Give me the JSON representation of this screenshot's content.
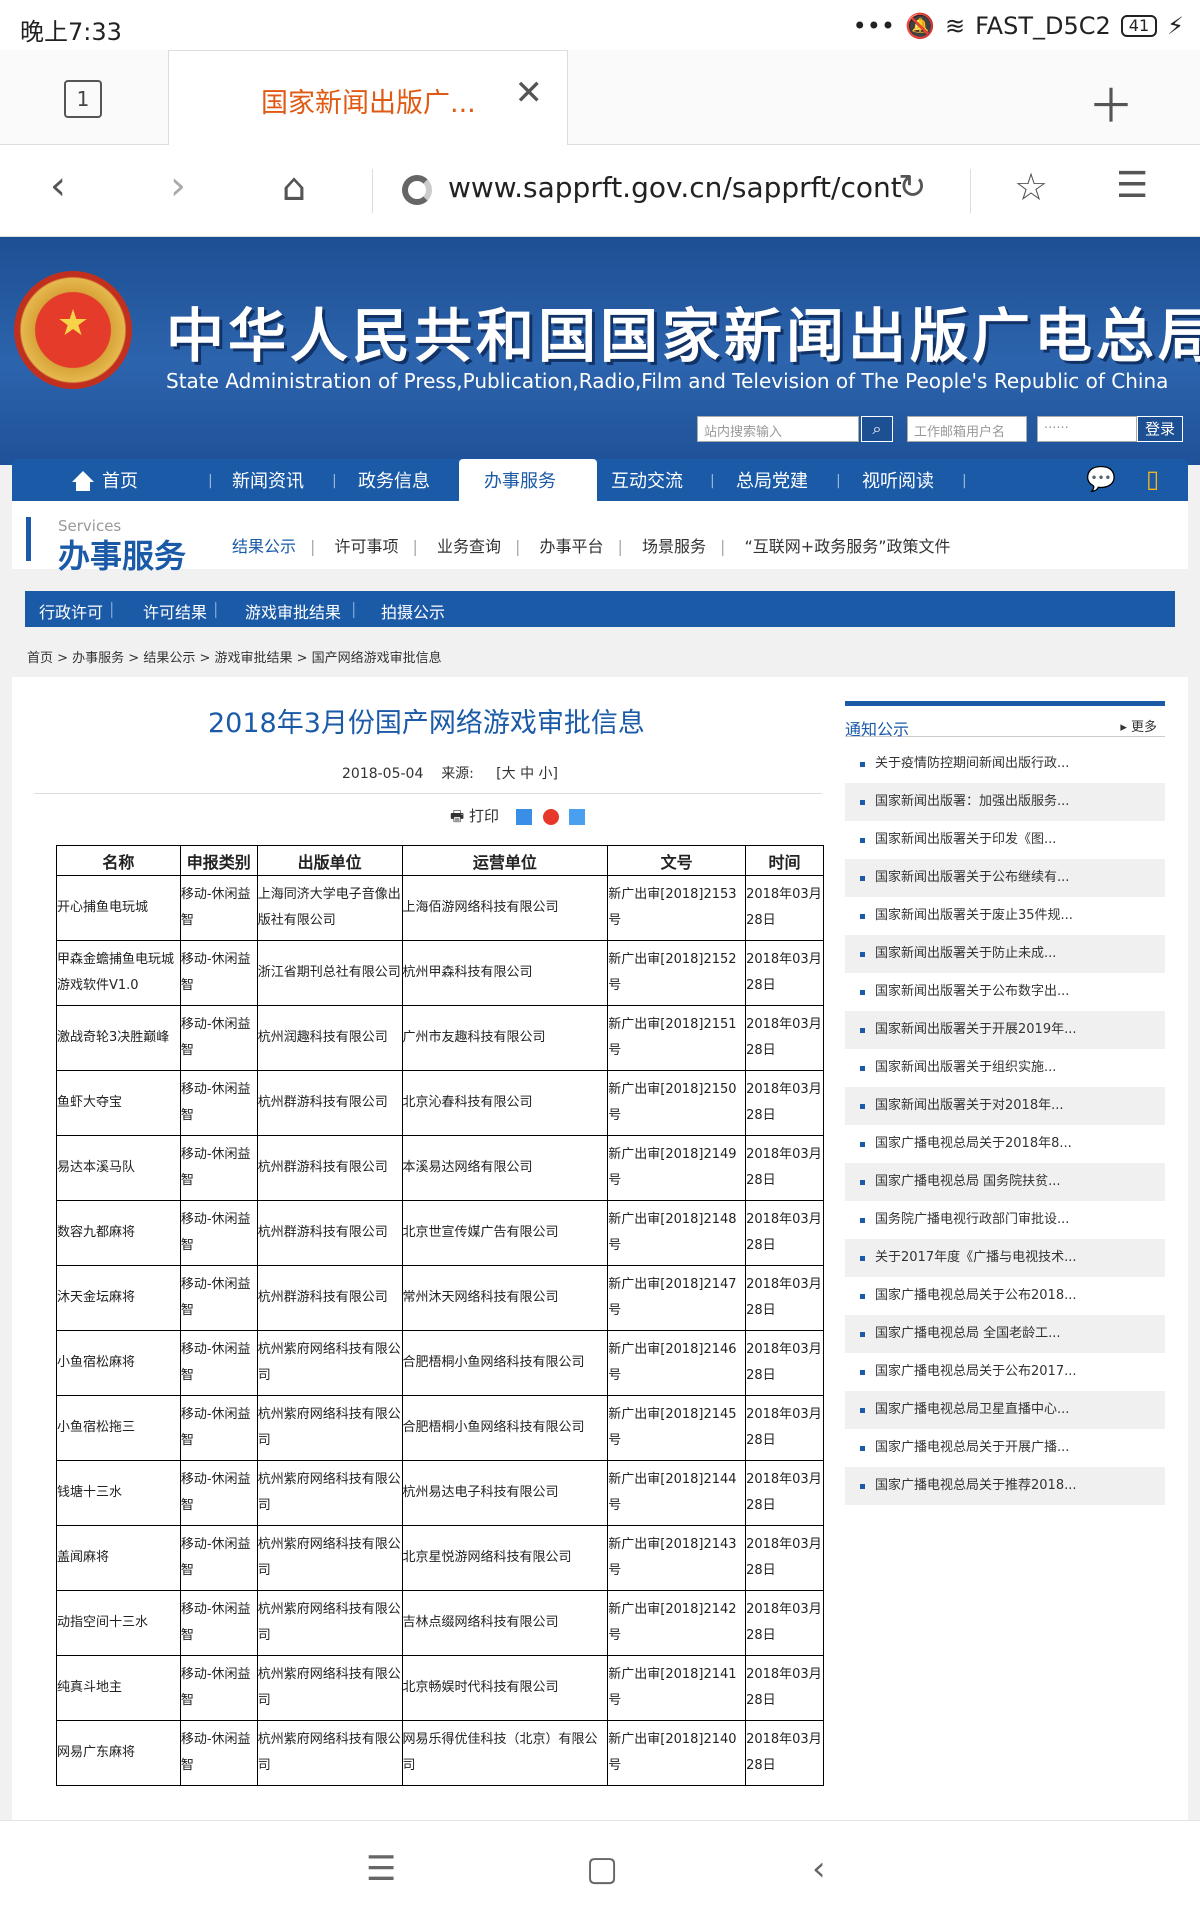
{
  "status": {
    "time": "晚上7:33",
    "wifi": "FAST_D5C2",
    "battery": "41"
  },
  "browser": {
    "tab_count": "1",
    "tab_title": "国家新闻出版广...",
    "url": "www.sapprft.gov.cn/sapprft/cont"
  },
  "header": {
    "title": "中华人民共和国国家新闻出版广电总局",
    "subtitle": "State Administration of Press,Publication,Radio,Film and Television of The People's Republic of China",
    "search_placeholder": "站内搜索输入",
    "mail_placeholder": "工作邮箱用户名",
    "password_placeholder": "······",
    "login_label": "登录"
  },
  "main_nav": [
    {
      "label": "首页"
    },
    {
      "label": "新闻资讯"
    },
    {
      "label": "政务信息"
    },
    {
      "label": "办事服务"
    },
    {
      "label": "互动交流"
    },
    {
      "label": "总局党建"
    },
    {
      "label": "视听阅读"
    }
  ],
  "services": {
    "word": "Services",
    "title": "办事服务",
    "links": [
      "结果公示",
      "许可事项",
      "业务查询",
      "办事平台",
      "场景服务",
      "“互联网+政务服务”政策文件"
    ]
  },
  "tab_nav": [
    "行政许可",
    "许可结果",
    "游戏审批结果",
    "拍摄公示"
  ],
  "breadcrumb": "首页 > 办事服务 > 结果公示 > 游戏审批结果 > 国产网络游戏审批信息",
  "article": {
    "title": "2018年3月份国产网络游戏审批信息",
    "date": "2018-05-04",
    "source_label": "来源:",
    "size_label": "[大 中 小]",
    "print_label": "打印"
  },
  "table": {
    "headers": [
      "名称",
      "申报类别",
      "出版单位",
      "运营单位",
      "文号",
      "时间"
    ],
    "rows": [
      [
        "开心捕鱼电玩城",
        "移动-休闲益智",
        "上海同济大学电子音像出版社有限公司",
        "上海佰游网络科技有限公司",
        "新广出审[2018]2153号",
        "2018年03月28日"
      ],
      [
        "甲森金蟾捕鱼电玩城游戏软件V1.0",
        "移动-休闲益智",
        "浙江省期刊总社有限公司",
        "杭州甲森科技有限公司",
        "新广出审[2018]2152号",
        "2018年03月28日"
      ],
      [
        "激战奇轮3决胜巅峰",
        "移动-休闲益智",
        "杭州润趣科技有限公司",
        "广州市友趣科技有限公司",
        "新广出审[2018]2151号",
        "2018年03月28日"
      ],
      [
        "鱼虾大夺宝",
        "移动-休闲益智",
        "杭州群游科技有限公司",
        "北京沁春科技有限公司",
        "新广出审[2018]2150号",
        "2018年03月28日"
      ],
      [
        "易达本溪马队",
        "移动-休闲益智",
        "杭州群游科技有限公司",
        "本溪易达网络有限公司",
        "新广出审[2018]2149号",
        "2018年03月28日"
      ],
      [
        "数容九都麻将",
        "移动-休闲益智",
        "杭州群游科技有限公司",
        "北京世宣传媒广告有限公司",
        "新广出审[2018]2148号",
        "2018年03月28日"
      ],
      [
        "沐天金坛麻将",
        "移动-休闲益智",
        "杭州群游科技有限公司",
        "常州沐天网络科技有限公司",
        "新广出审[2018]2147号",
        "2018年03月28日"
      ],
      [
        "小鱼宿松麻将",
        "移动-休闲益智",
        "杭州紫府网络科技有限公司",
        "合肥梧桐小鱼网络科技有限公司",
        "新广出审[2018]2146号",
        "2018年03月28日"
      ],
      [
        "小鱼宿松拖三",
        "移动-休闲益智",
        "杭州紫府网络科技有限公司",
        "合肥梧桐小鱼网络科技有限公司",
        "新广出审[2018]2145号",
        "2018年03月28日"
      ],
      [
        "钱塘十三水",
        "移动-休闲益智",
        "杭州紫府网络科技有限公司",
        "杭州易达电子科技有限公司",
        "新广出审[2018]2144号",
        "2018年03月28日"
      ],
      [
        "盖闻麻将",
        "移动-休闲益智",
        "杭州紫府网络科技有限公司",
        "北京星悦游网络科技有限公司",
        "新广出审[2018]2143号",
        "2018年03月28日"
      ],
      [
        "动指空间十三水",
        "移动-休闲益智",
        "杭州紫府网络科技有限公司",
        "吉林点缀网络科技有限公司",
        "新广出审[2018]2142号",
        "2018年03月28日"
      ],
      [
        "纯真斗地主",
        "移动-休闲益智",
        "杭州紫府网络科技有限公司",
        "北京畅娱时代科技有限公司",
        "新广出审[2018]2141号",
        "2018年03月28日"
      ],
      [
        "网易广东麻将",
        "移动-休闲益智",
        "杭州紫府网络科技有限公司",
        "网易乐得优佳科技（北京）有限公司",
        "新广出审[2018]2140号",
        "2018年03月28日"
      ]
    ]
  },
  "sidebar": {
    "title": "通知公示",
    "more": "▸ 更多",
    "items": [
      "关于疫情防控期间新闻出版行政...",
      "国家新闻出版署：加强出版服务...",
      "国家新闻出版署关于印发《图...",
      "国家新闻出版署关于公布继续有...",
      "国家新闻出版署关于废止35件规...",
      "国家新闻出版署关于防止未成...",
      "国家新闻出版署关于公布数字出...",
      "国家新闻出版署关于开展2019年...",
      "国家新闻出版署关于组织实施...",
      "国家新闻出版署关于对2018年...",
      "国家广播电视总局关于2018年8...",
      "国家广播电视总局 国务院扶贫...",
      "国务院广播电视行政部门审批设...",
      "关于2017年度《广播与电视技术...",
      "国家广播电视总局关于公布2018...",
      "国家广播电视总局 全国老龄工...",
      "国家广播电视总局关于公布2017...",
      "国家广播电视总局卫星直播中心...",
      "国家广播电视总局关于开展广播...",
      "国家广播电视总局关于推荐2018..."
    ]
  },
  "colors": {
    "primary": "#1a5aa7",
    "tab_accent": "#e05a14"
  }
}
